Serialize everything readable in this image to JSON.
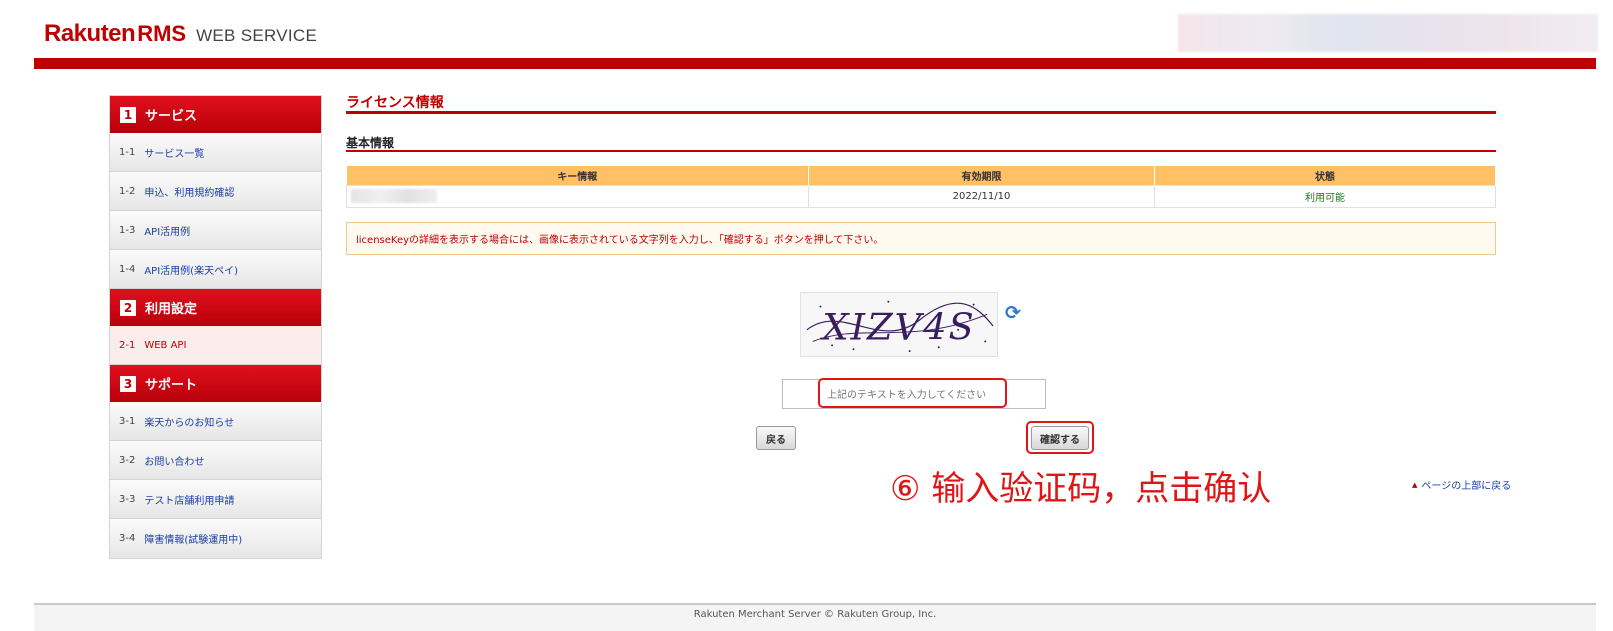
{
  "header": {
    "logo_brand": "Rakuten",
    "logo_rms": "RMS",
    "logo_service": "WEB SERVICE"
  },
  "sidebar": {
    "sections": [
      {
        "num": "1",
        "title": "サービス",
        "items": [
          {
            "num": "1-1",
            "label": "サービス一覧"
          },
          {
            "num": "1-2",
            "label": "申込、利用規約確認"
          },
          {
            "num": "1-3",
            "label": "API活用例"
          },
          {
            "num": "1-4",
            "label": "API活用例(楽天ペイ)"
          }
        ]
      },
      {
        "num": "2",
        "title": "利用設定",
        "items": [
          {
            "num": "2-1",
            "label": "WEB API"
          }
        ]
      },
      {
        "num": "3",
        "title": "サポート",
        "items": [
          {
            "num": "3-1",
            "label": "楽天からのお知らせ"
          },
          {
            "num": "3-2",
            "label": "お問い合わせ"
          },
          {
            "num": "3-3",
            "label": "テスト店舗利用申請"
          },
          {
            "num": "3-4",
            "label": "障害情報(試験運用中)"
          }
        ]
      }
    ]
  },
  "main": {
    "page_title": "ライセンス情報",
    "section_title": "基本情報",
    "table": {
      "headers": [
        "キー情報",
        "有効期限",
        "状態"
      ],
      "row": {
        "expiry": "2022/11/10",
        "status": "利用可能"
      }
    },
    "notice": "licenseKeyの詳細を表示する場合には、画像に表示されている文字列を入力し、「確認する」ボタンを押して下さい。",
    "captcha_text": "XIZV4S",
    "captcha_placeholder": "上記のテキストを入力してください",
    "back_button": "戻る",
    "confirm_button": "確認する",
    "page_top_link": "ページの上部に戻る"
  },
  "annotation": "⑥ 输入验证码，点击确认",
  "footer": "Rakuten Merchant Server © Rakuten Group, Inc.",
  "colors": {
    "brand_red": "#bf0000",
    "table_header": "#ffc066",
    "annotation_red": "#e01515",
    "status_green": "#1d7a1d",
    "link_blue": "#1a3ea4"
  }
}
